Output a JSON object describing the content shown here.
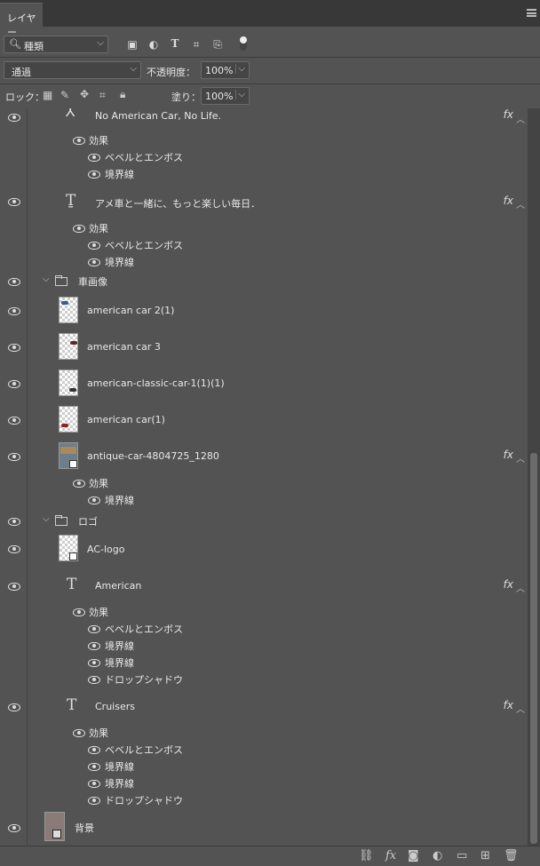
{
  "panel": {
    "tab_title": "レイヤー"
  },
  "filter": {
    "kind": "種類"
  },
  "blend": {
    "mode": "通過",
    "opacity_label": "不透明度：",
    "opacity": "100%",
    "lock_label": "ロック：",
    "fill_label": "塗り：",
    "fill": "100%"
  },
  "layers": {
    "l1": {
      "name": "No American Car, No Life.",
      "effects": "効果",
      "e1": "ベベルとエンボス",
      "e2": "境界線"
    },
    "l2": {
      "name": "アメ車と一緒に、もっと楽しい毎日．",
      "effects": "効果",
      "e1": "ベベルとエンボス",
      "e2": "境界線"
    },
    "g1": {
      "name": "車画像"
    },
    "c1": {
      "name": "american car 2(1)"
    },
    "c2": {
      "name": "american car 3"
    },
    "c3": {
      "name": "american-classic-car-1(1)(1)"
    },
    "c4": {
      "name": "american car(1)"
    },
    "c5": {
      "name": "antique-car-4804725_1280",
      "effects": "効果",
      "e1": "境界線"
    },
    "g2": {
      "name": "ロゴ"
    },
    "logo": {
      "name": "AC-logo"
    },
    "t1": {
      "name": "American",
      "effects": "効果",
      "e1": "ベベルとエンボス",
      "e2": "境界線",
      "e3": "境界線",
      "e4": "ドロップシャドウ"
    },
    "t2": {
      "name": "Cruisers",
      "effects": "効果",
      "e1": "ベベルとエンボス",
      "e2": "境界線",
      "e3": "境界線",
      "e4": "ドロップシャドウ"
    },
    "bg": {
      "name": "背景"
    }
  },
  "fx_label": "fx",
  "icons": [
    "search-icon",
    "image-filter-icon",
    "adjustment-filter-icon",
    "type-filter-icon",
    "shape-filter-icon",
    "smartobject-filter-icon",
    "filter-toggle-icon",
    "eye-icon",
    "link-icon",
    "fx-icon",
    "mask-icon",
    "adjustment-icon",
    "folder-icon",
    "new-layer-icon",
    "trash-icon"
  ]
}
